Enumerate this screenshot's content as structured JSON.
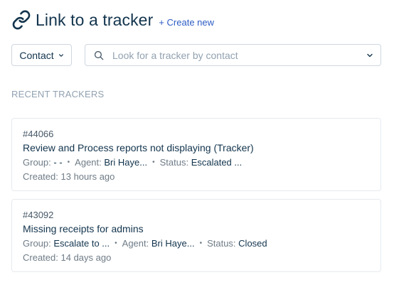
{
  "header": {
    "title": "Link to a tracker",
    "create_new": "+ Create new",
    "icon": "link-icon"
  },
  "controls": {
    "filter_value": "Contact",
    "search_placeholder": "Look for a tracker by contact"
  },
  "section": {
    "label": "RECENT TRACKERS"
  },
  "trackers": [
    {
      "id": "#44066",
      "subject": "Review and Process reports not displaying (Tracker)",
      "group_label": "Group:",
      "group_value": "- -",
      "agent_label": "Agent:",
      "agent_value": "Bri Haye...",
      "status_label": "Status:",
      "status_value": "Escalated ...",
      "created_label": "Created:",
      "created_value": "13 hours ago"
    },
    {
      "id": "#43092",
      "subject": "Missing receipts for admins",
      "group_label": "Group:",
      "group_value": "Escalate to ...",
      "agent_label": "Agent:",
      "agent_value": "Bri Haye...",
      "status_label": "Status:",
      "status_value": "Closed",
      "created_label": "Created:",
      "created_value": "14 days ago"
    }
  ],
  "colors": {
    "accent": "#2c5cc5",
    "text": "#12344d",
    "muted": "#92a2b1",
    "border": "#e6eaee"
  }
}
